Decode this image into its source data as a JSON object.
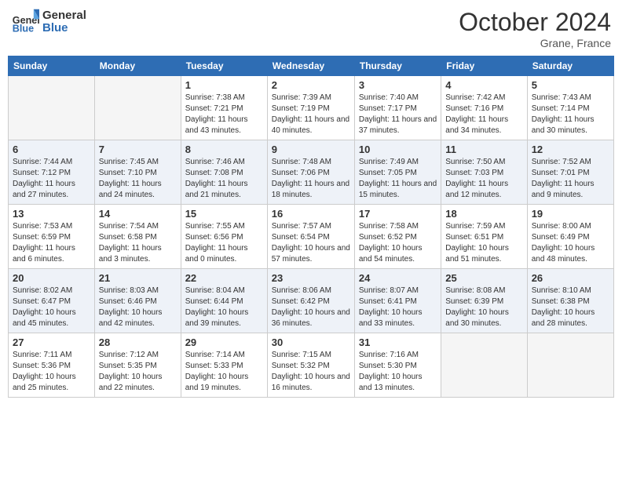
{
  "header": {
    "logo_line1": "General",
    "logo_line2": "Blue",
    "month": "October 2024",
    "location": "Grane, France"
  },
  "weekdays": [
    "Sunday",
    "Monday",
    "Tuesday",
    "Wednesday",
    "Thursday",
    "Friday",
    "Saturday"
  ],
  "weeks": [
    [
      {
        "day": "",
        "info": ""
      },
      {
        "day": "",
        "info": ""
      },
      {
        "day": "1",
        "info": "Sunrise: 7:38 AM\nSunset: 7:21 PM\nDaylight: 11 hours and 43 minutes."
      },
      {
        "day": "2",
        "info": "Sunrise: 7:39 AM\nSunset: 7:19 PM\nDaylight: 11 hours and 40 minutes."
      },
      {
        "day": "3",
        "info": "Sunrise: 7:40 AM\nSunset: 7:17 PM\nDaylight: 11 hours and 37 minutes."
      },
      {
        "day": "4",
        "info": "Sunrise: 7:42 AM\nSunset: 7:16 PM\nDaylight: 11 hours and 34 minutes."
      },
      {
        "day": "5",
        "info": "Sunrise: 7:43 AM\nSunset: 7:14 PM\nDaylight: 11 hours and 30 minutes."
      }
    ],
    [
      {
        "day": "6",
        "info": "Sunrise: 7:44 AM\nSunset: 7:12 PM\nDaylight: 11 hours and 27 minutes."
      },
      {
        "day": "7",
        "info": "Sunrise: 7:45 AM\nSunset: 7:10 PM\nDaylight: 11 hours and 24 minutes."
      },
      {
        "day": "8",
        "info": "Sunrise: 7:46 AM\nSunset: 7:08 PM\nDaylight: 11 hours and 21 minutes."
      },
      {
        "day": "9",
        "info": "Sunrise: 7:48 AM\nSunset: 7:06 PM\nDaylight: 11 hours and 18 minutes."
      },
      {
        "day": "10",
        "info": "Sunrise: 7:49 AM\nSunset: 7:05 PM\nDaylight: 11 hours and 15 minutes."
      },
      {
        "day": "11",
        "info": "Sunrise: 7:50 AM\nSunset: 7:03 PM\nDaylight: 11 hours and 12 minutes."
      },
      {
        "day": "12",
        "info": "Sunrise: 7:52 AM\nSunset: 7:01 PM\nDaylight: 11 hours and 9 minutes."
      }
    ],
    [
      {
        "day": "13",
        "info": "Sunrise: 7:53 AM\nSunset: 6:59 PM\nDaylight: 11 hours and 6 minutes."
      },
      {
        "day": "14",
        "info": "Sunrise: 7:54 AM\nSunset: 6:58 PM\nDaylight: 11 hours and 3 minutes."
      },
      {
        "day": "15",
        "info": "Sunrise: 7:55 AM\nSunset: 6:56 PM\nDaylight: 11 hours and 0 minutes."
      },
      {
        "day": "16",
        "info": "Sunrise: 7:57 AM\nSunset: 6:54 PM\nDaylight: 10 hours and 57 minutes."
      },
      {
        "day": "17",
        "info": "Sunrise: 7:58 AM\nSunset: 6:52 PM\nDaylight: 10 hours and 54 minutes."
      },
      {
        "day": "18",
        "info": "Sunrise: 7:59 AM\nSunset: 6:51 PM\nDaylight: 10 hours and 51 minutes."
      },
      {
        "day": "19",
        "info": "Sunrise: 8:00 AM\nSunset: 6:49 PM\nDaylight: 10 hours and 48 minutes."
      }
    ],
    [
      {
        "day": "20",
        "info": "Sunrise: 8:02 AM\nSunset: 6:47 PM\nDaylight: 10 hours and 45 minutes."
      },
      {
        "day": "21",
        "info": "Sunrise: 8:03 AM\nSunset: 6:46 PM\nDaylight: 10 hours and 42 minutes."
      },
      {
        "day": "22",
        "info": "Sunrise: 8:04 AM\nSunset: 6:44 PM\nDaylight: 10 hours and 39 minutes."
      },
      {
        "day": "23",
        "info": "Sunrise: 8:06 AM\nSunset: 6:42 PM\nDaylight: 10 hours and 36 minutes."
      },
      {
        "day": "24",
        "info": "Sunrise: 8:07 AM\nSunset: 6:41 PM\nDaylight: 10 hours and 33 minutes."
      },
      {
        "day": "25",
        "info": "Sunrise: 8:08 AM\nSunset: 6:39 PM\nDaylight: 10 hours and 30 minutes."
      },
      {
        "day": "26",
        "info": "Sunrise: 8:10 AM\nSunset: 6:38 PM\nDaylight: 10 hours and 28 minutes."
      }
    ],
    [
      {
        "day": "27",
        "info": "Sunrise: 7:11 AM\nSunset: 5:36 PM\nDaylight: 10 hours and 25 minutes."
      },
      {
        "day": "28",
        "info": "Sunrise: 7:12 AM\nSunset: 5:35 PM\nDaylight: 10 hours and 22 minutes."
      },
      {
        "day": "29",
        "info": "Sunrise: 7:14 AM\nSunset: 5:33 PM\nDaylight: 10 hours and 19 minutes."
      },
      {
        "day": "30",
        "info": "Sunrise: 7:15 AM\nSunset: 5:32 PM\nDaylight: 10 hours and 16 minutes."
      },
      {
        "day": "31",
        "info": "Sunrise: 7:16 AM\nSunset: 5:30 PM\nDaylight: 10 hours and 13 minutes."
      },
      {
        "day": "",
        "info": ""
      },
      {
        "day": "",
        "info": ""
      }
    ]
  ]
}
